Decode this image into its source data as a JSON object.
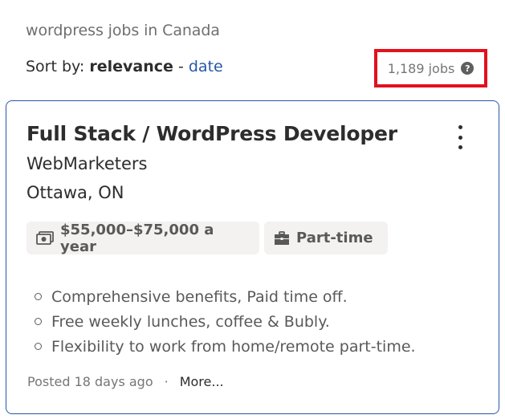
{
  "header": {
    "query_title": "wordpress jobs in Canada",
    "sort_label": "Sort by:",
    "sort_active": "relevance",
    "sort_separator": "-",
    "sort_alternative": "date",
    "job_count": "1,189 jobs",
    "help_glyph": "?",
    "highlight_color": "#e3101e"
  },
  "job": {
    "title": "Full Stack / WordPress Developer",
    "company": "WebMarketers",
    "location": "Ottawa, ON",
    "salary": "$55,000–$75,000 a year",
    "salary_icon": "money-icon",
    "job_type": "Part-time",
    "job_type_icon": "briefcase-icon",
    "menu_icon": "kebab-menu-icon",
    "snippet": [
      "Comprehensive benefits, Paid time off.",
      "Free weekly lunches, coffee & Bubly.",
      "Flexibility to work from home/remote part-time."
    ],
    "posted": "Posted 18 days ago",
    "separator": "·",
    "more_label": "More..."
  },
  "colors": {
    "link": "#2557a7",
    "card_border": "#2557a7",
    "chip_bg": "#f3f2f1"
  }
}
